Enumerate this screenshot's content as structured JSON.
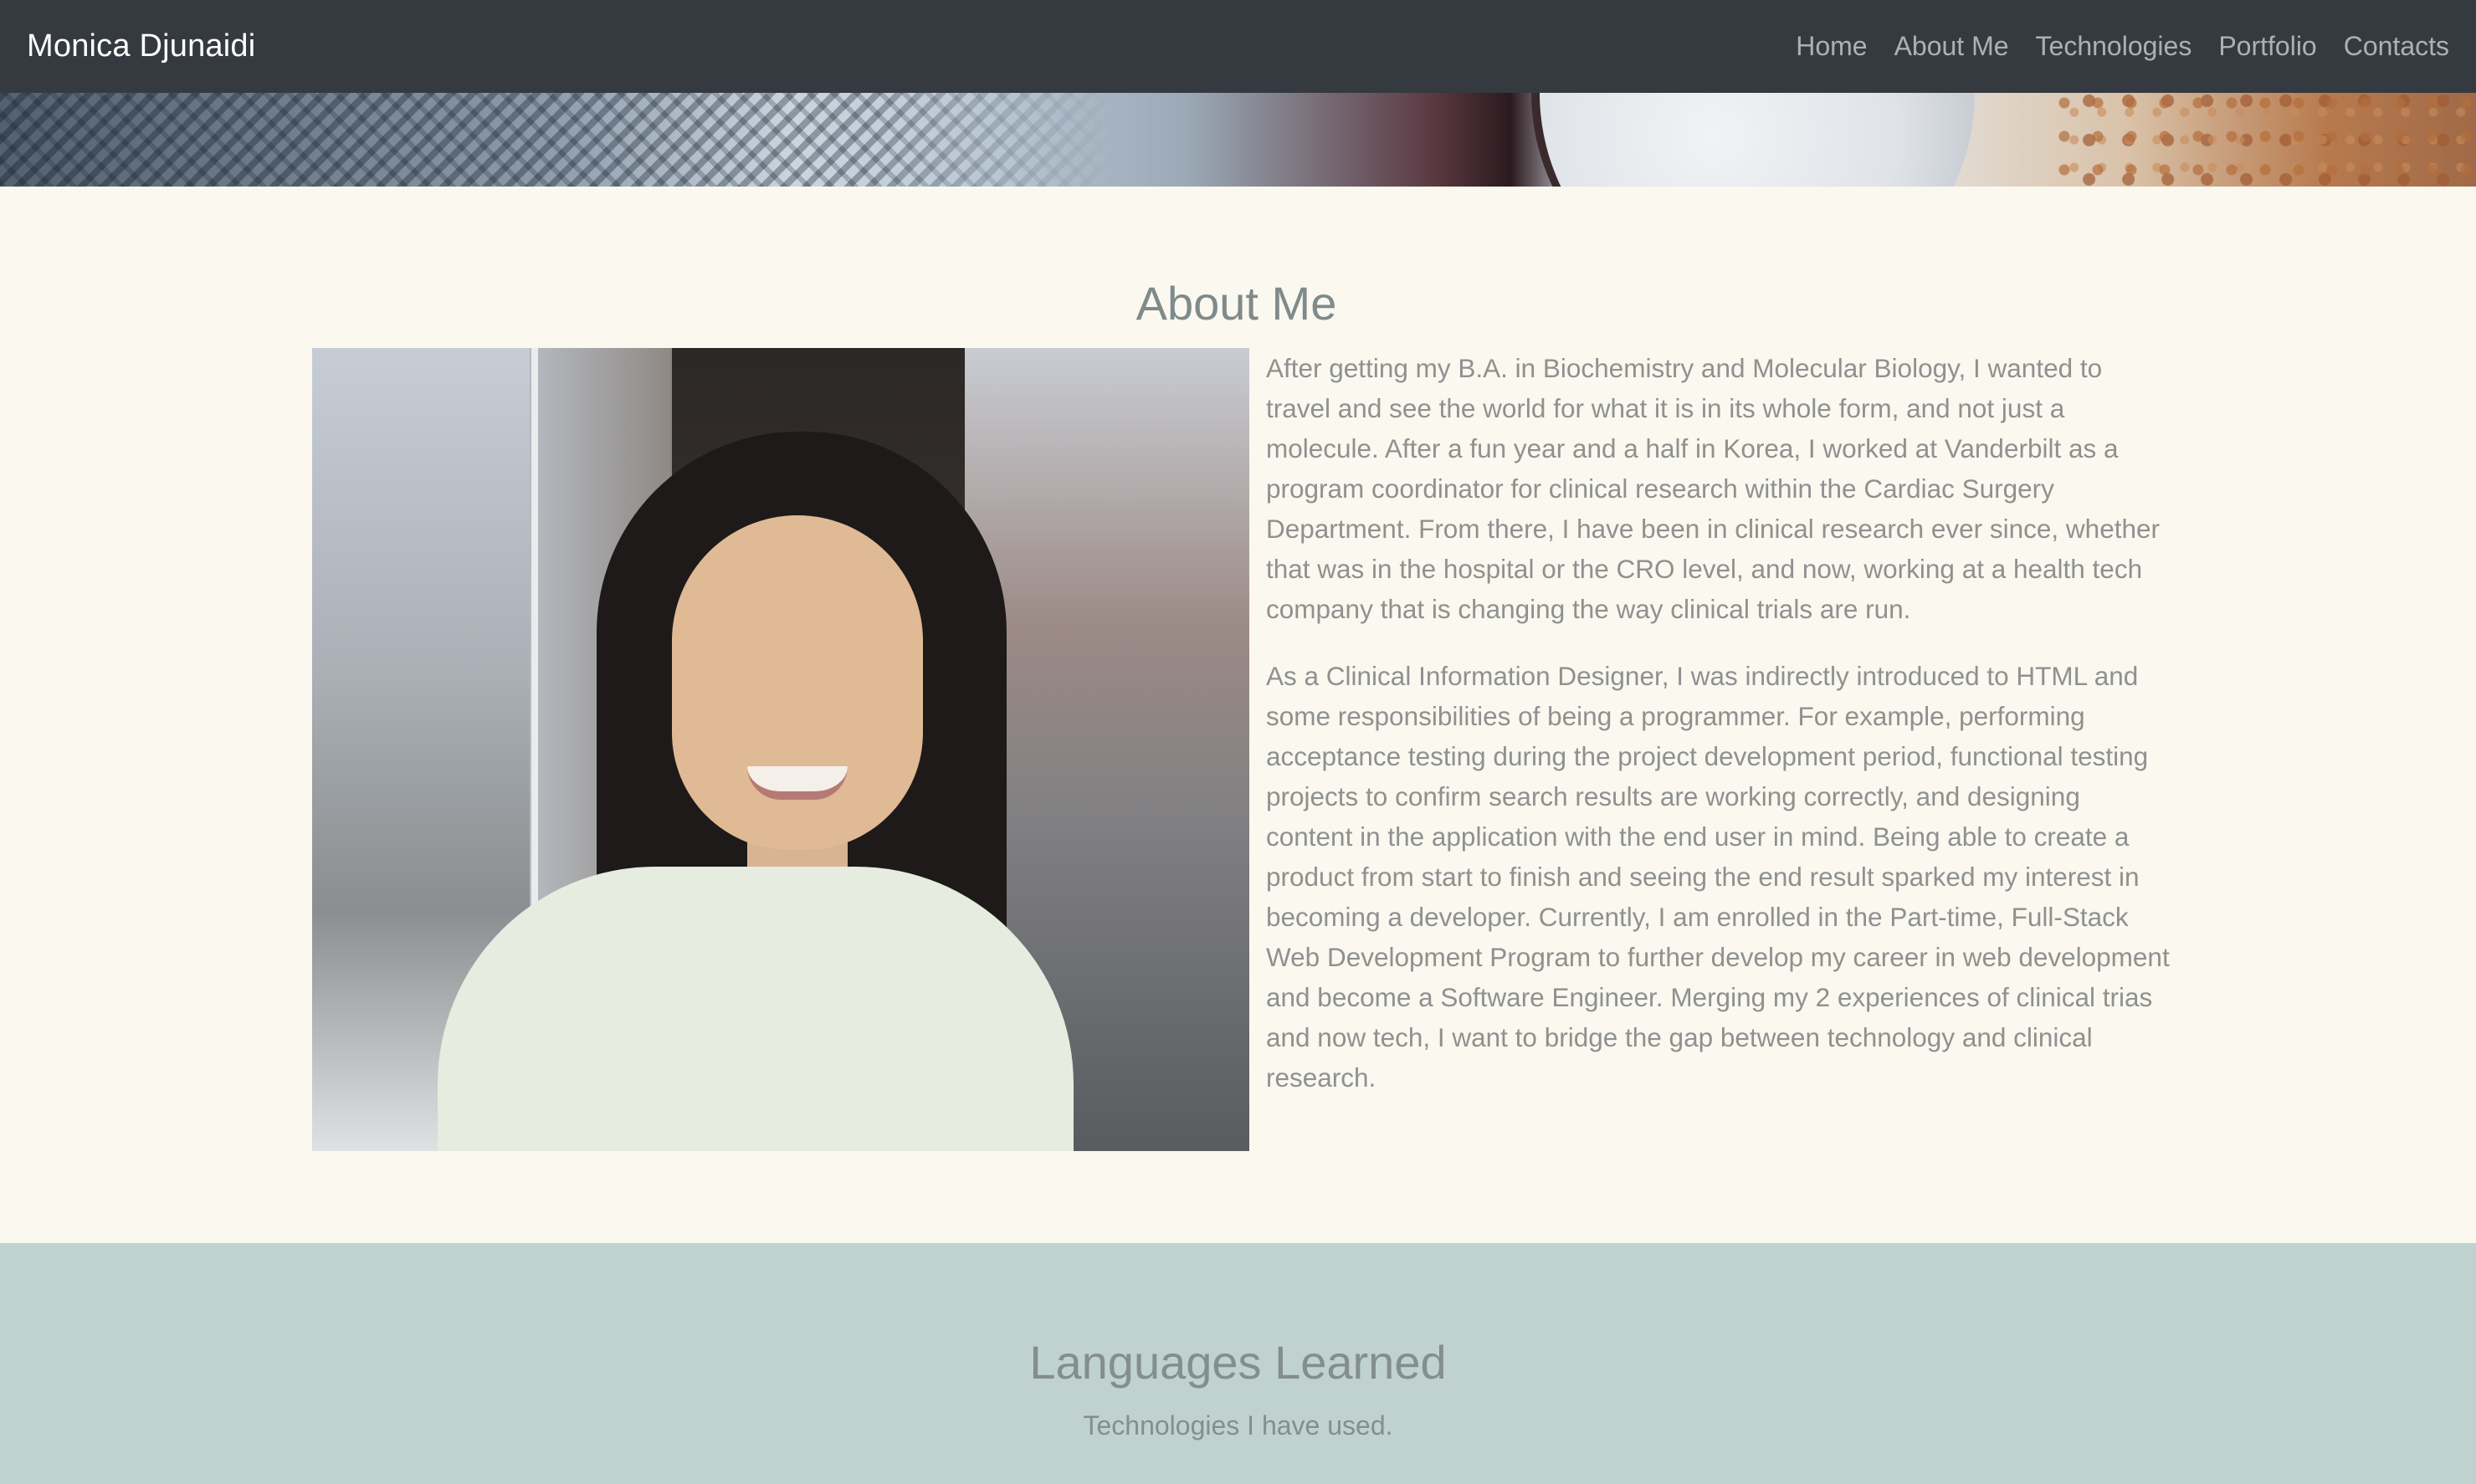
{
  "navbar": {
    "brand": "Monica Djunaidi",
    "links": [
      "Home",
      "About Me",
      "Technologies",
      "Portfolio",
      "Contacts"
    ],
    "background_color": "#343a40"
  },
  "about": {
    "title": "About Me",
    "paragraphs": [
      "After getting my B.A. in Biochemistry and Molecular Biology, I wanted to travel and see the world for what it is in its whole form, and not just a molecule. After a fun year and a half in Korea, I worked at Vanderbilt as a program coordinator for clinical research within the Cardiac Surgery Department. From there, I have been in clinical research ever since, whether that was in the hospital or the CRO level, and now, working at a health tech company that is changing the way clinical trials are run.",
      "As a Clinical Information Designer, I was indirectly introduced to HTML and some responsibilities of being a programmer. For example, performing acceptance testing during the project development period, functional testing projects to confirm search results are working correctly, and designing content in the application with the end user in mind. Being able to create a product from start to finish and seeing the end result sparked my interest in becoming a developer. Currently, I am enrolled in the Part-time, Full-Stack Web Development Program to further develop my career in web development and become a Software Engineer. Merging my 2 experiences of clinical trias and now tech, I want to bridge the gap between technology and clinical research."
    ],
    "background_color": "#faf8ef"
  },
  "languages": {
    "title": "Languages Learned",
    "subtitle": "Technologies I have used.",
    "background_color": "#bfd2cf"
  }
}
